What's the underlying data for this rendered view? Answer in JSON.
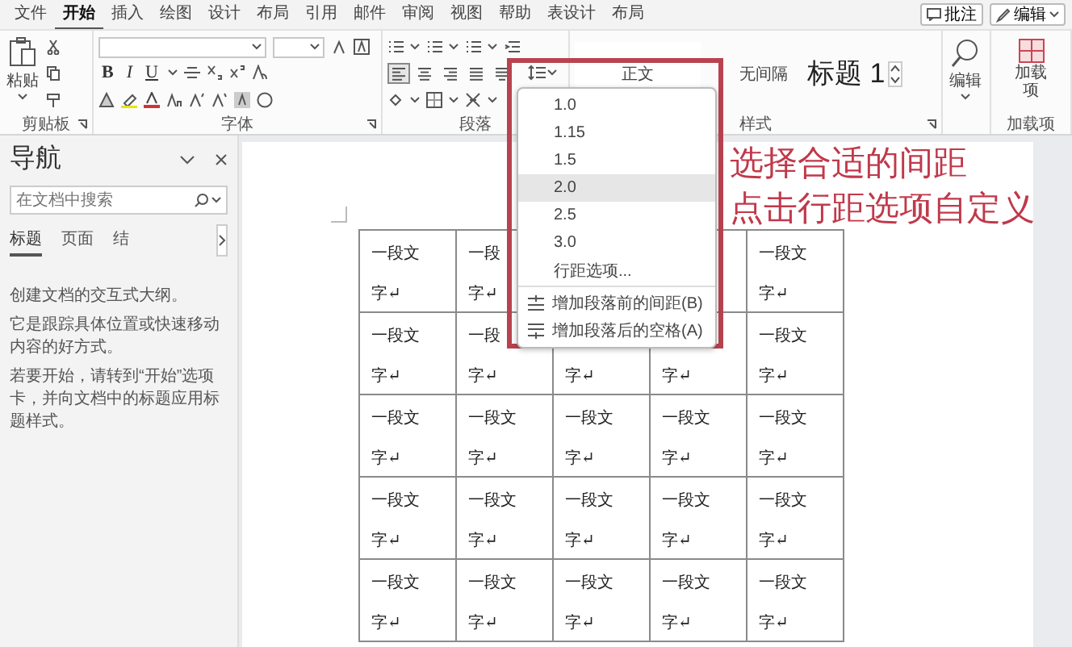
{
  "menu_tabs": [
    {
      "label": "文件",
      "selected": false
    },
    {
      "label": "开始",
      "selected": true
    },
    {
      "label": "插入",
      "selected": false
    },
    {
      "label": "绘图",
      "selected": false
    },
    {
      "label": "设计",
      "selected": false
    },
    {
      "label": "布局",
      "selected": false
    },
    {
      "label": "引用",
      "selected": false
    },
    {
      "label": "邮件",
      "selected": false
    },
    {
      "label": "审阅",
      "selected": false
    },
    {
      "label": "视图",
      "selected": false
    },
    {
      "label": "帮助",
      "selected": false
    },
    {
      "label": "表设计",
      "selected": false
    },
    {
      "label": "布局",
      "selected": false
    }
  ],
  "header_buttons": {
    "comments": "批注",
    "editing": "编辑"
  },
  "ribbon": {
    "clipboard": {
      "title": "剪贴板",
      "paste": "粘贴"
    },
    "font": {
      "title": "字体",
      "format_buttons": [
        "B",
        "I",
        "U"
      ]
    },
    "paragraph": {
      "title": "段落",
      "alignments": [
        {
          "kind": "left",
          "selected": true
        },
        {
          "kind": "center",
          "selected": false
        },
        {
          "kind": "right",
          "selected": false
        },
        {
          "kind": "justify",
          "selected": false
        },
        {
          "kind": "distributed",
          "selected": false
        }
      ]
    },
    "styles": {
      "title": "样式",
      "items": [
        {
          "kind": "normal",
          "label": "正文"
        },
        {
          "kind": "plain",
          "label": "无间隔"
        },
        {
          "kind": "heading",
          "label": "标题 1"
        }
      ]
    },
    "editing": {
      "label": "编辑"
    },
    "addins": {
      "label": "加载项",
      "title": "加载项"
    }
  },
  "line_spacing_menu": {
    "items": [
      {
        "kind": "value",
        "label": "1.0",
        "selected": false
      },
      {
        "kind": "value",
        "label": "1.15",
        "selected": false
      },
      {
        "kind": "value",
        "label": "1.5",
        "selected": false
      },
      {
        "kind": "value",
        "label": "2.0",
        "selected": true
      },
      {
        "kind": "value",
        "label": "2.5",
        "selected": false
      },
      {
        "kind": "value",
        "label": "3.0",
        "selected": false
      },
      {
        "kind": "options",
        "label": "行距选项...",
        "selected": false
      },
      {
        "kind": "space-before",
        "label": "增加段落前的间距(B)",
        "selected": false
      },
      {
        "kind": "space-after",
        "label": "增加段落后的空格(A)",
        "selected": false
      }
    ]
  },
  "annotation": {
    "lines": [
      "选择合适的间距",
      "点击行距选项自定义"
    ]
  },
  "navigation": {
    "title": "导航",
    "search": {
      "placeholder": "在文档中搜索"
    },
    "tabs": [
      {
        "label": "标题",
        "selected": true
      },
      {
        "label": "页面",
        "selected": false
      },
      {
        "label": "结",
        "selected": false
      }
    ],
    "paragraphs": [
      "创建文档的交互式大纲。",
      "它是跟踪具体位置或快速移动内容的好方式。",
      "若要开始，请转到“开始”选项卡，并向文档中的标题应用标题样式。"
    ]
  },
  "document": {
    "table": {
      "rows": [
        [
          {
            "line_1": "一段文",
            "line_2": "字↵"
          },
          {
            "line_1": "一段",
            "line_2": "字↵"
          },
          {},
          {},
          {
            "line_1": "一段文",
            "line_2": "字↵"
          }
        ],
        [
          {
            "line_1": "一段文",
            "line_2": "字↵"
          },
          {
            "line_1": "一段",
            "line_2": "字↵"
          },
          {
            "line_2": "字↵"
          },
          {
            "line_2": "字↵"
          },
          {
            "line_1": "一段文",
            "line_2": "字↵"
          }
        ],
        [
          {
            "line_1": "一段文",
            "line_2": "字↵"
          },
          {
            "line_1": "一段文",
            "line_2": "字↵"
          },
          {
            "line_1": "一段文",
            "line_2": "字↵"
          },
          {
            "line_1": "一段文",
            "line_2": "字↵"
          },
          {
            "line_1": "一段文",
            "line_2": "字↵"
          }
        ],
        [
          {
            "line_1": "一段文",
            "line_2": "字↵"
          },
          {
            "line_1": "一段文",
            "line_2": "字↵"
          },
          {
            "line_1": "一段文",
            "line_2": "字↵"
          },
          {
            "line_1": "一段文",
            "line_2": "字↵"
          },
          {
            "line_1": "一段文",
            "line_2": "字↵"
          }
        ],
        [
          {
            "line_1": "一段文",
            "line_2": "字↵"
          },
          {
            "line_1": "一段文",
            "line_2": "字↵"
          },
          {
            "line_1": "一段文",
            "line_2": "字↵"
          },
          {
            "line_1": "一段文",
            "line_2": "字↵"
          },
          {
            "line_1": "一段文",
            "line_2": "字↵"
          }
        ]
      ]
    }
  }
}
